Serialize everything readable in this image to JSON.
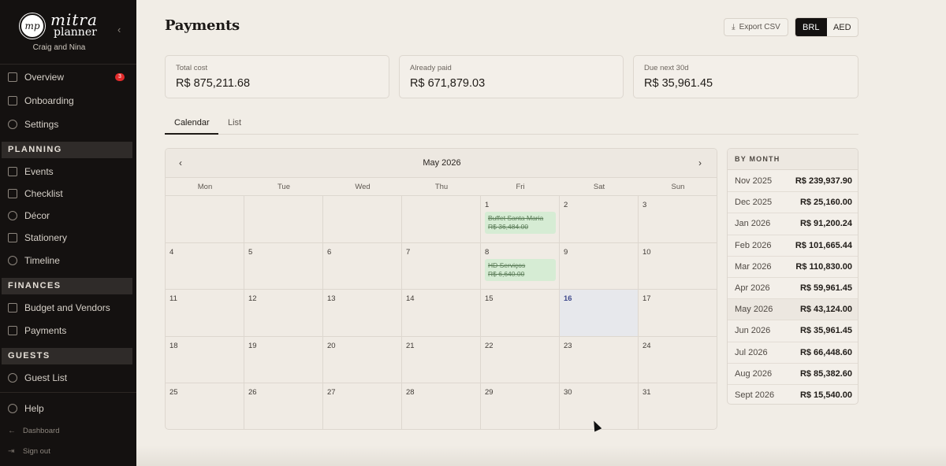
{
  "brand": {
    "word1": "mitra",
    "word2": "planner",
    "monogram": "mp",
    "couple": "Craig and Nina"
  },
  "sidebar": {
    "top_items": [
      {
        "label": "Overview",
        "icon": "grid-icon",
        "badge": "3"
      },
      {
        "label": "Onboarding",
        "icon": "clipboard-icon"
      },
      {
        "label": "Settings",
        "icon": "gear-icon"
      }
    ],
    "sections": {
      "planning": "PLANNING",
      "finances": "FINANCES",
      "guests": "GUESTS"
    },
    "planning_items": [
      {
        "label": "Events",
        "icon": "calendar-icon"
      },
      {
        "label": "Checklist",
        "icon": "checklist-icon"
      },
      {
        "label": "Décor",
        "icon": "palette-icon"
      },
      {
        "label": "Stationery",
        "icon": "sparkle-icon"
      },
      {
        "label": "Timeline",
        "icon": "clock-icon"
      }
    ],
    "finance_items": [
      {
        "label": "Budget and Vendors",
        "icon": "wallet-icon"
      },
      {
        "label": "Payments",
        "icon": "card-icon"
      }
    ],
    "guest_items": [
      {
        "label": "Guest List",
        "icon": "users-icon"
      }
    ],
    "help": "Help",
    "dashboard": "Dashboard",
    "signout": "Sign out"
  },
  "header": {
    "title": "Payments",
    "export_label": "Export CSV",
    "currencies": [
      "BRL",
      "AED"
    ],
    "active_currency": "BRL"
  },
  "stats": [
    {
      "label": "Total cost",
      "value": "R$ 875,211.68"
    },
    {
      "label": "Already paid",
      "value": "R$ 671,879.03"
    },
    {
      "label": "Due next 30d",
      "value": "R$ 35,961.45"
    }
  ],
  "tabs": [
    {
      "label": "Calendar",
      "active": true
    },
    {
      "label": "List",
      "active": false
    }
  ],
  "calendar": {
    "month_title": "May 2026",
    "prev": "‹",
    "next": "›",
    "weekdays": [
      "Mon",
      "Tue",
      "Wed",
      "Thu",
      "Fri",
      "Sat",
      "Sun"
    ],
    "today": 16,
    "events": {
      "1": {
        "name": "Buffet Santa Maria",
        "amount": "R$ 36,484.00"
      },
      "8": {
        "name": "HD Serviços",
        "amount": "R$ 6,640.00"
      }
    }
  },
  "by_month": {
    "title": "BY MONTH",
    "current": "May 2026",
    "rows": [
      {
        "month": "Nov 2025",
        "amount": "R$ 239,937.90"
      },
      {
        "month": "Dec 2025",
        "amount": "R$ 25,160.00"
      },
      {
        "month": "Jan 2026",
        "amount": "R$ 91,200.24"
      },
      {
        "month": "Feb 2026",
        "amount": "R$ 101,665.44"
      },
      {
        "month": "Mar 2026",
        "amount": "R$ 110,830.00"
      },
      {
        "month": "Apr 2026",
        "amount": "R$ 59,961.45"
      },
      {
        "month": "May 2026",
        "amount": "R$ 43,124.00"
      },
      {
        "month": "Jun 2026",
        "amount": "R$ 35,961.45"
      },
      {
        "month": "Jul 2026",
        "amount": "R$ 66,448.60"
      },
      {
        "month": "Aug 2026",
        "amount": "R$ 85,382.60"
      },
      {
        "month": "Sept 2026",
        "amount": "R$ 15,540.00"
      }
    ]
  },
  "colors": {
    "sidebar_bg": "#141110",
    "page_bg": "#f1ede6",
    "badge": "#e22b2b",
    "event_bg": "#d6ecd4",
    "today_bg": "#e7e8ec"
  }
}
